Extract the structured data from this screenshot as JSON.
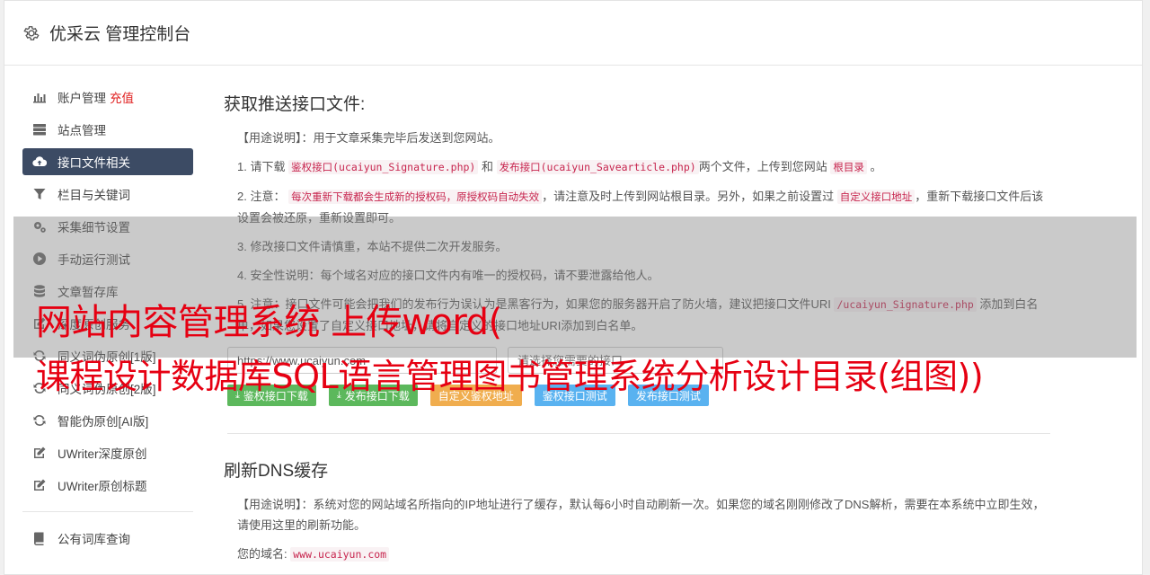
{
  "header": {
    "title": "优采云 管理控制台",
    "icon": "gear-icon"
  },
  "sidebar": {
    "items": [
      {
        "label": "账户管理",
        "extra": "充值",
        "icon": "bar-chart-icon"
      },
      {
        "label": "站点管理",
        "icon": "server-icon"
      },
      {
        "label": "接口文件相关",
        "icon": "cloud-upload-icon",
        "active": true
      },
      {
        "label": "栏目与关键词",
        "icon": "filter-icon"
      },
      {
        "label": "采集细节设置",
        "icon": "cogs-icon"
      },
      {
        "label": "手动运行测试",
        "icon": "play-circle-icon"
      },
      {
        "label": "文章暂存库",
        "icon": "database-icon"
      },
      {
        "label": "深度原创服务",
        "icon": "edit-icon"
      },
      {
        "label": "同义词伪原创[1版]",
        "icon": "refresh-icon"
      },
      {
        "label": "同义词伪原创[2版]",
        "icon": "refresh-icon"
      },
      {
        "label": "智能伪原创[AI版]",
        "icon": "refresh-icon"
      },
      {
        "label": "UWriter深度原创",
        "icon": "edit-icon"
      },
      {
        "label": "UWriter原创标题",
        "icon": "edit-icon"
      },
      {
        "label": "公有词库查询",
        "icon": "book-icon"
      }
    ]
  },
  "interface_section": {
    "title": "获取推送接口文件:",
    "usage": "【用途说明】：用于文章采集完毕后发送到您网站。",
    "p1_prefix": "1. 请下载",
    "p1_code1": "鉴权接口(ucaiyun_Signature.php)",
    "p1_and": "和",
    "p1_code2": "发布接口(ucaiyun_Savearticle.php)",
    "p1_mid": "两个文件，上传到您网站",
    "p1_code3": "根目录",
    "p1_end": "。",
    "p2_prefix": "2. 注意：",
    "p2_code1": "每次重新下载都会生成新的授权码，原授权码自动失效",
    "p2_mid": "，请注意及时上传到网站根目录。另外，如果之前设置过",
    "p2_code2": "自定义接口地址",
    "p2_end": "，重新下载接口文件后该设置会被还原，重新设置即可。",
    "p3": "3. 修改接口文件请慎重，本站不提供二次开发服务。",
    "p4": "4. 安全性说明：每个域名对应的接口文件内有唯一的授权码，请不要泄露给他人。",
    "p5_prefix": "5. 注意：接口文件可能会把我们的发布行为误认为是黑客行为，如果您的服务器开启了防火墙，建议把接口文件URI",
    "p5_code": "/ucaiyun_Signature.php",
    "p5_end": "添加到白名单，如果您设置了自定义接口地址，请将自定义的接口地址URI添加到白名单。",
    "domain_value": "https://www.ucaiyun.com",
    "select_placeholder": "请选择您需要的接口",
    "buttons": {
      "sign_download": "鉴权接口下载",
      "publish_download": "发布接口下载",
      "custom_sign": "自定义鉴权地址",
      "sign_test": "鉴权接口测试",
      "publish_test": "发布接口测试"
    }
  },
  "dns_section": {
    "title": "刷新DNS缓存",
    "usage": "【用途说明】：系统对您的网站域名所指向的IP地址进行了缓存，默认每6小时自动刷新一次。如果您的域名刚刚修改了DNS解析，需要在本系统中立即生效，请使用这里的刷新功能。",
    "domain_label": "您的域名:",
    "domain_value": "www.ucaiyun.com"
  },
  "overlay": {
    "line1": "网站内容管理系统 上传word(",
    "line2": "课程设计数据库SQL语言管理图书管理系统分析设计目录(组图))"
  },
  "colors": {
    "active_nav": "#3c4b64",
    "green_button": "#5cb85c",
    "orange_button": "#f0ad4e",
    "blue_button": "#59b2f0",
    "overlay_text": "#e60012",
    "recharge_text": "#e02020"
  }
}
